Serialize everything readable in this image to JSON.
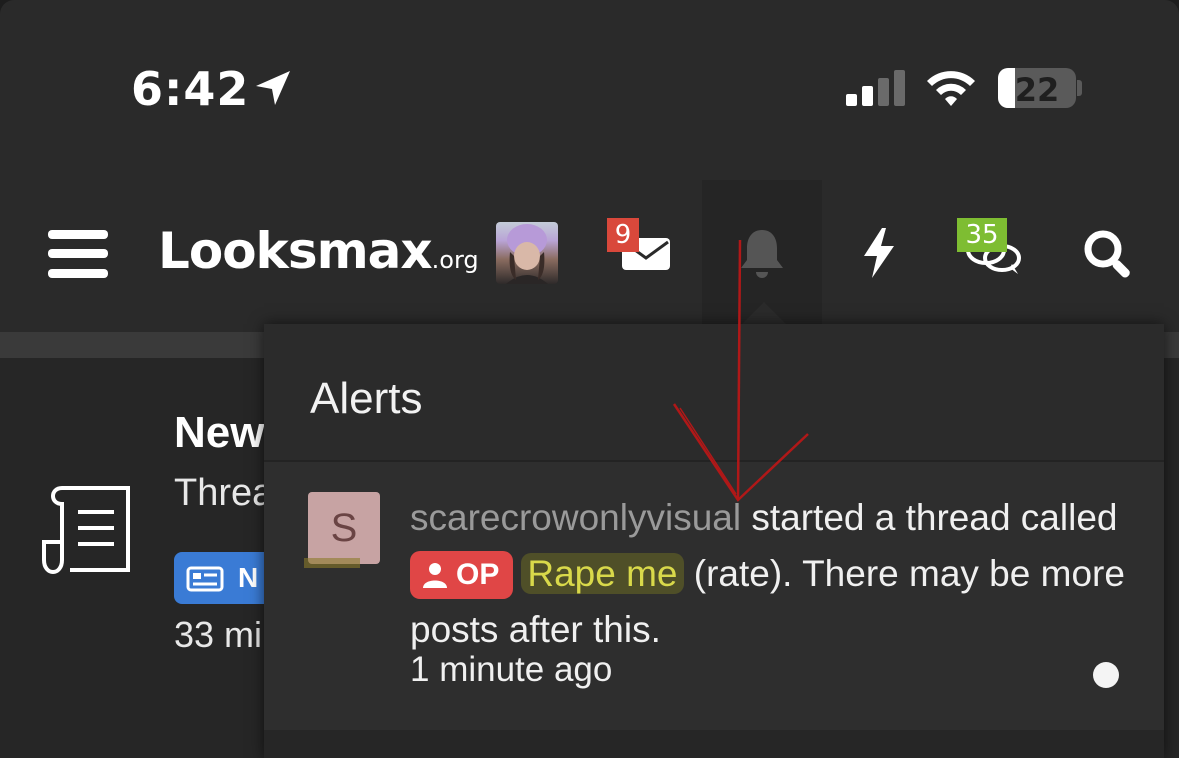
{
  "status_bar": {
    "time": "6:42",
    "battery_level": "22",
    "battery_fraction": 0.22
  },
  "navbar": {
    "logo_main": "Looksmax",
    "logo_suffix": ".org",
    "mail_badge": "9",
    "chat_badge": "35",
    "colors": {
      "mail_badge": "#d9483b",
      "chat_badge": "#7ebd32"
    }
  },
  "background_item": {
    "title": "New",
    "subtitle": "Threa",
    "tag": "N",
    "time": "33 mi"
  },
  "alerts": {
    "title": "Alerts",
    "items": [
      {
        "avatar_letter": "S",
        "username": "scarecrowonlyvisual",
        "text_before": " started a thread called ",
        "badge": "OP",
        "thread_title": "Rape me",
        "text_after": " (rate). There may be more posts after this.",
        "time": "1 minute ago",
        "unread": true
      }
    ]
  },
  "icons": [
    "location-arrow-icon",
    "signal-icon",
    "wifi-icon",
    "battery-icon",
    "menu-icon",
    "envelope-icon",
    "bell-icon",
    "bolt-icon",
    "chat-bubbles-icon",
    "search-icon",
    "document-icon",
    "user-icon"
  ]
}
